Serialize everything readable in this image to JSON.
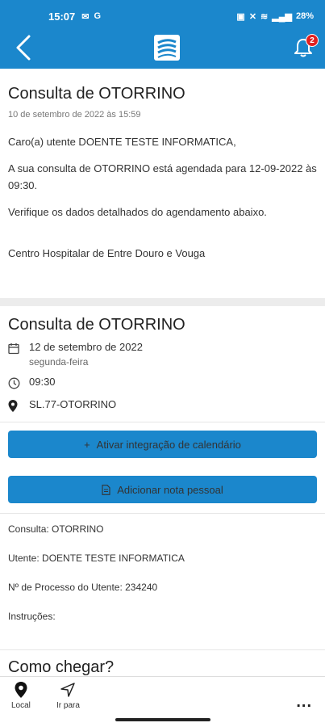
{
  "status_bar": {
    "time": "15:07",
    "battery": "28%"
  },
  "header": {
    "notification_count": "2",
    "accent": "#1b87cc"
  },
  "message": {
    "title": "Consulta de OTORRINO",
    "date": "10 de setembro de 2022 às 15:59",
    "greeting": "Caro(a) utente DOENTE TESTE INFORMATICA,",
    "body": "A sua consulta de OTORRINO está agendada para 12-09-2022 às 09:30.",
    "note": "Verifique os dados detalhados do agendamento abaixo.",
    "institution": "Centro Hospitalar de Entre Douro e Vouga"
  },
  "appointment": {
    "title": "Consulta de OTORRINO",
    "date": "12 de setembro de 2022",
    "weekday": "segunda-feira",
    "time": "09:30",
    "location": "SL.77-OTORRINO"
  },
  "actions": {
    "calendar": "Ativar integração de calendário",
    "note": "Adicionar nota pessoal"
  },
  "details": {
    "consulta": "Consulta: OTORRINO",
    "utente": "Utente: DOENTE TESTE INFORMATICA",
    "processo": "Nº de Processo do Utente: 234240",
    "instrucoes": "Instruções:"
  },
  "directions": {
    "title": "Como chegar?"
  },
  "bottom_nav": {
    "local": "Local",
    "ir_para": "Ir para",
    "more": "..."
  }
}
